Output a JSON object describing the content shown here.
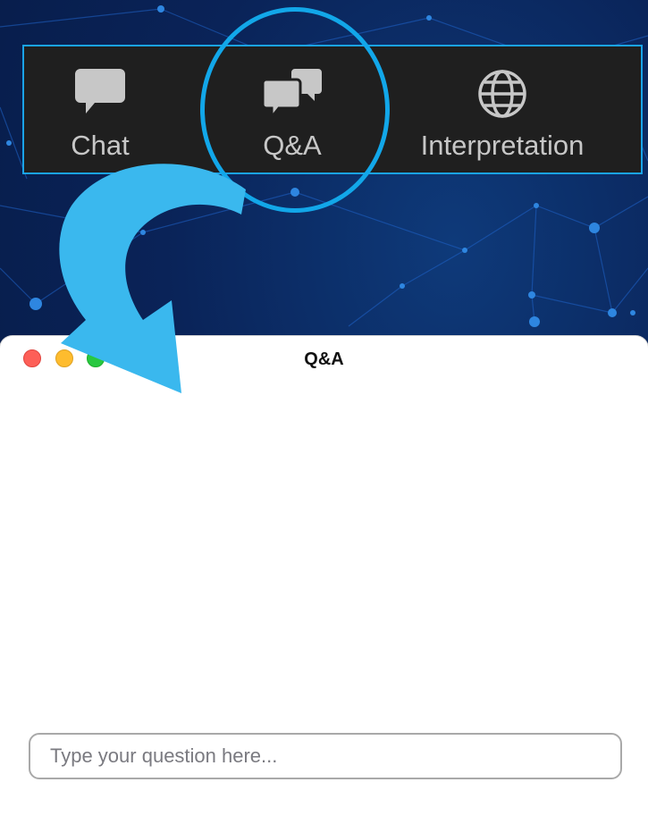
{
  "toolbar": {
    "items": [
      {
        "label": "Chat",
        "icon": "chat-bubble-icon"
      },
      {
        "label": "Q&A",
        "icon": "qa-bubbles-icon"
      },
      {
        "label": "Interpretation",
        "icon": "globe-icon"
      }
    ]
  },
  "qa_window": {
    "title": "Q&A",
    "input_placeholder": "Type your question here...",
    "input_value": ""
  },
  "colors": {
    "highlight": "#12a7e9",
    "arrow": "#3ab8ee",
    "toolbar_bg": "#1f1f1f",
    "toolbar_text": "#c7c7c7",
    "background": "#0a2358"
  }
}
